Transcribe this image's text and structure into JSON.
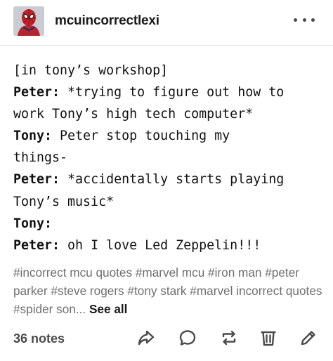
{
  "post": {
    "blog_name": "mcuincorrectlexi",
    "avatar_icon": "spider-man-avatar-icon",
    "more_icon": "more-options-icon",
    "lines": [
      {
        "speaker": "",
        "text": "[in tony’s workshop]"
      },
      {
        "speaker": "Peter:",
        "text": " *trying to figure out how to"
      },
      {
        "speaker": "",
        "text": "work Tony’s high tech computer*"
      },
      {
        "speaker": "Tony:",
        "text": " Peter stop touching my"
      },
      {
        "speaker": "",
        "text": "things-"
      },
      {
        "speaker": "Peter:",
        "text": " *accidentally starts playing"
      },
      {
        "speaker": "",
        "text": "Tony’s music*"
      },
      {
        "speaker": "Tony:",
        "text": ""
      },
      {
        "speaker": "Peter:",
        "text": " oh I love Led Zeppelin!!!"
      }
    ],
    "tags": [
      "#incorrect mcu quotes",
      "#marvel mcu",
      "#iron man",
      "#peter parker",
      "#steve rogers",
      "#tony stark",
      "#marvel incorrect quotes",
      "#spider son..."
    ],
    "see_all": "See all",
    "notes": "36 notes",
    "icons": [
      "share-icon",
      "reply-icon",
      "reblog-icon",
      "delete-icon",
      "edit-icon"
    ],
    "icon_color": "#4a4a4a"
  }
}
